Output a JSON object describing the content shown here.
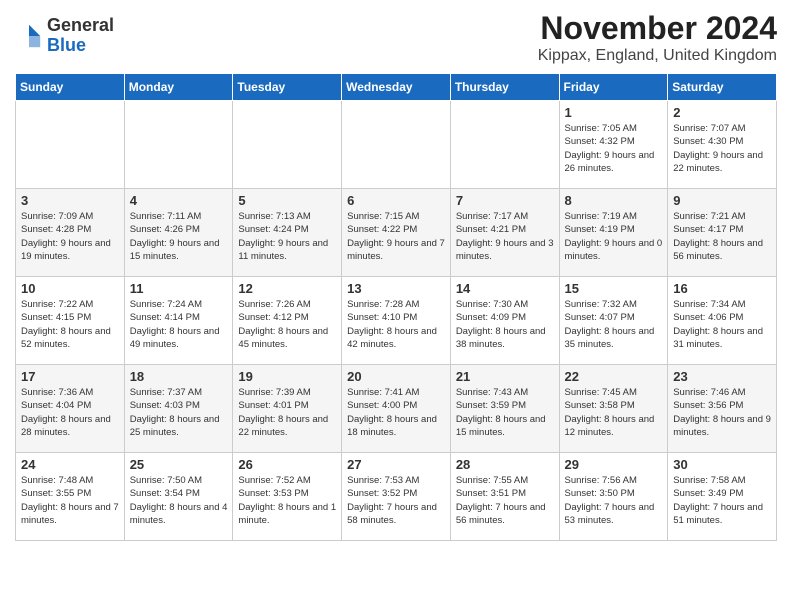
{
  "logo": {
    "general": "General",
    "blue": "Blue"
  },
  "header": {
    "month": "November 2024",
    "location": "Kippax, England, United Kingdom"
  },
  "weekdays": [
    "Sunday",
    "Monday",
    "Tuesday",
    "Wednesday",
    "Thursday",
    "Friday",
    "Saturday"
  ],
  "weeks": [
    [
      {
        "day": "",
        "info": ""
      },
      {
        "day": "",
        "info": ""
      },
      {
        "day": "",
        "info": ""
      },
      {
        "day": "",
        "info": ""
      },
      {
        "day": "",
        "info": ""
      },
      {
        "day": "1",
        "info": "Sunrise: 7:05 AM\nSunset: 4:32 PM\nDaylight: 9 hours and 26 minutes."
      },
      {
        "day": "2",
        "info": "Sunrise: 7:07 AM\nSunset: 4:30 PM\nDaylight: 9 hours and 22 minutes."
      }
    ],
    [
      {
        "day": "3",
        "info": "Sunrise: 7:09 AM\nSunset: 4:28 PM\nDaylight: 9 hours and 19 minutes."
      },
      {
        "day": "4",
        "info": "Sunrise: 7:11 AM\nSunset: 4:26 PM\nDaylight: 9 hours and 15 minutes."
      },
      {
        "day": "5",
        "info": "Sunrise: 7:13 AM\nSunset: 4:24 PM\nDaylight: 9 hours and 11 minutes."
      },
      {
        "day": "6",
        "info": "Sunrise: 7:15 AM\nSunset: 4:22 PM\nDaylight: 9 hours and 7 minutes."
      },
      {
        "day": "7",
        "info": "Sunrise: 7:17 AM\nSunset: 4:21 PM\nDaylight: 9 hours and 3 minutes."
      },
      {
        "day": "8",
        "info": "Sunrise: 7:19 AM\nSunset: 4:19 PM\nDaylight: 9 hours and 0 minutes."
      },
      {
        "day": "9",
        "info": "Sunrise: 7:21 AM\nSunset: 4:17 PM\nDaylight: 8 hours and 56 minutes."
      }
    ],
    [
      {
        "day": "10",
        "info": "Sunrise: 7:22 AM\nSunset: 4:15 PM\nDaylight: 8 hours and 52 minutes."
      },
      {
        "day": "11",
        "info": "Sunrise: 7:24 AM\nSunset: 4:14 PM\nDaylight: 8 hours and 49 minutes."
      },
      {
        "day": "12",
        "info": "Sunrise: 7:26 AM\nSunset: 4:12 PM\nDaylight: 8 hours and 45 minutes."
      },
      {
        "day": "13",
        "info": "Sunrise: 7:28 AM\nSunset: 4:10 PM\nDaylight: 8 hours and 42 minutes."
      },
      {
        "day": "14",
        "info": "Sunrise: 7:30 AM\nSunset: 4:09 PM\nDaylight: 8 hours and 38 minutes."
      },
      {
        "day": "15",
        "info": "Sunrise: 7:32 AM\nSunset: 4:07 PM\nDaylight: 8 hours and 35 minutes."
      },
      {
        "day": "16",
        "info": "Sunrise: 7:34 AM\nSunset: 4:06 PM\nDaylight: 8 hours and 31 minutes."
      }
    ],
    [
      {
        "day": "17",
        "info": "Sunrise: 7:36 AM\nSunset: 4:04 PM\nDaylight: 8 hours and 28 minutes."
      },
      {
        "day": "18",
        "info": "Sunrise: 7:37 AM\nSunset: 4:03 PM\nDaylight: 8 hours and 25 minutes."
      },
      {
        "day": "19",
        "info": "Sunrise: 7:39 AM\nSunset: 4:01 PM\nDaylight: 8 hours and 22 minutes."
      },
      {
        "day": "20",
        "info": "Sunrise: 7:41 AM\nSunset: 4:00 PM\nDaylight: 8 hours and 18 minutes."
      },
      {
        "day": "21",
        "info": "Sunrise: 7:43 AM\nSunset: 3:59 PM\nDaylight: 8 hours and 15 minutes."
      },
      {
        "day": "22",
        "info": "Sunrise: 7:45 AM\nSunset: 3:58 PM\nDaylight: 8 hours and 12 minutes."
      },
      {
        "day": "23",
        "info": "Sunrise: 7:46 AM\nSunset: 3:56 PM\nDaylight: 8 hours and 9 minutes."
      }
    ],
    [
      {
        "day": "24",
        "info": "Sunrise: 7:48 AM\nSunset: 3:55 PM\nDaylight: 8 hours and 7 minutes."
      },
      {
        "day": "25",
        "info": "Sunrise: 7:50 AM\nSunset: 3:54 PM\nDaylight: 8 hours and 4 minutes."
      },
      {
        "day": "26",
        "info": "Sunrise: 7:52 AM\nSunset: 3:53 PM\nDaylight: 8 hours and 1 minute."
      },
      {
        "day": "27",
        "info": "Sunrise: 7:53 AM\nSunset: 3:52 PM\nDaylight: 7 hours and 58 minutes."
      },
      {
        "day": "28",
        "info": "Sunrise: 7:55 AM\nSunset: 3:51 PM\nDaylight: 7 hours and 56 minutes."
      },
      {
        "day": "29",
        "info": "Sunrise: 7:56 AM\nSunset: 3:50 PM\nDaylight: 7 hours and 53 minutes."
      },
      {
        "day": "30",
        "info": "Sunrise: 7:58 AM\nSunset: 3:49 PM\nDaylight: 7 hours and 51 minutes."
      }
    ]
  ]
}
